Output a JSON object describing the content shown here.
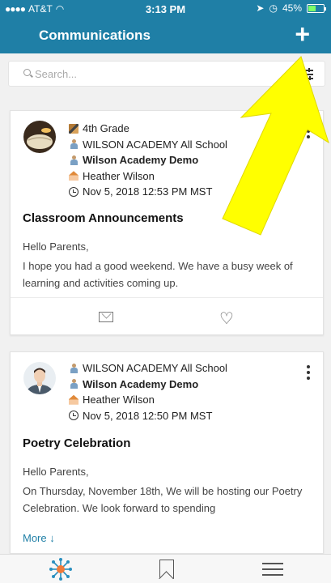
{
  "status_bar": {
    "carrier": "AT&T",
    "time": "3:13 PM",
    "battery": "45%"
  },
  "header": {
    "title": "Communications",
    "add_icon": "plus-icon"
  },
  "search": {
    "placeholder": "Search..."
  },
  "posts": [
    {
      "grade": "4th Grade",
      "school": "WILSON ACADEMY All School",
      "organization": "Wilson Academy Demo",
      "author": "Heather Wilson",
      "timestamp": "Nov 5, 2018 12:53 PM MST",
      "title": "Classroom Announcements",
      "greeting": "Hello Parents,",
      "body": "I hope you had a good weekend.  We have a busy week of learning and activities coming up."
    },
    {
      "school": "WILSON ACADEMY All School",
      "organization": "Wilson Academy Demo",
      "author": "Heather Wilson",
      "timestamp": "Nov 5, 2018 12:50 PM MST",
      "title": "Poetry Celebration",
      "greeting": "Hello Parents,",
      "body": "On Thursday, November 18th,  We will be hosting our Poetry Celebration.  We look forward to spending",
      "more_label": "More ↓"
    }
  ],
  "colors": {
    "brand": "#1f7fa6",
    "annotation_arrow": "#ffff00"
  },
  "tab_bar": {
    "items": [
      "network-icon",
      "bookmark-icon",
      "menu-icon"
    ]
  }
}
